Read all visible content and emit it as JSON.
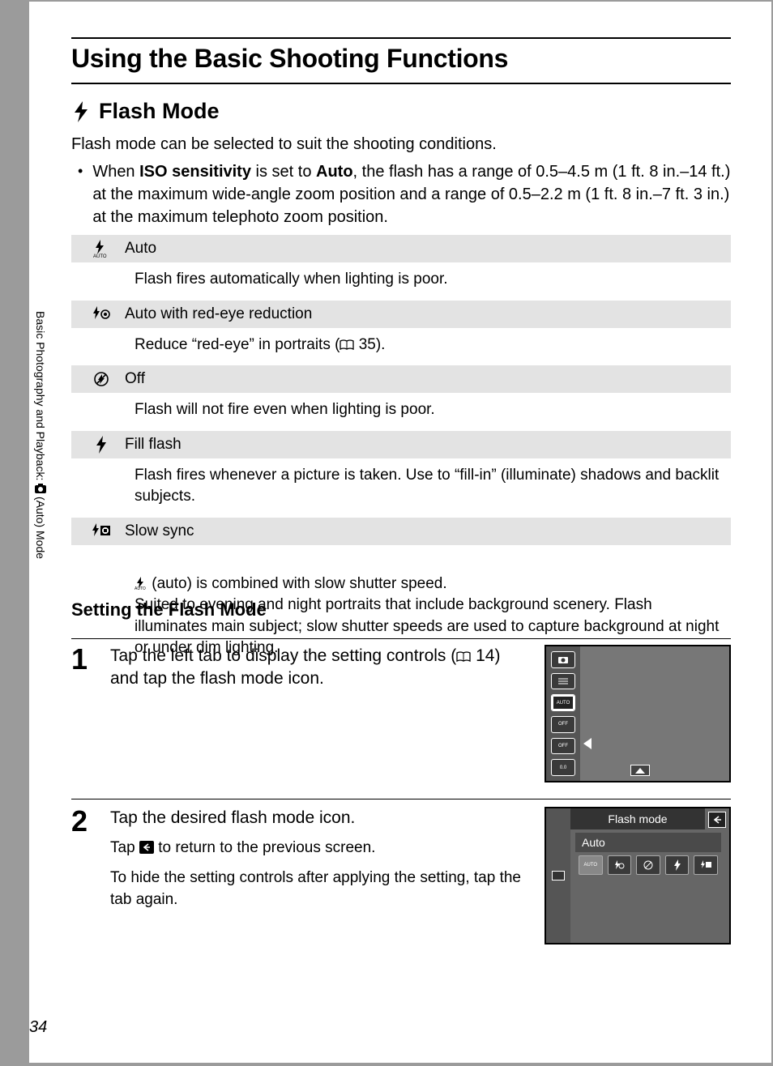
{
  "page_number": "34",
  "side_tab": {
    "prefix": "Basic Photography and Playback: ",
    "suffix": " (Auto) Mode"
  },
  "chapter_title": "Using the Basic Shooting Functions",
  "section": {
    "icon": "flash-bolt-icon",
    "title": "Flash Mode"
  },
  "intro": "Flash mode can be selected to suit the shooting conditions.",
  "bullet": {
    "pre": "When ",
    "b1": "ISO sensitivity",
    "mid": " is set to ",
    "b2": "Auto",
    "post": ", the flash has a range of 0.5–4.5 m (1 ft. 8 in.–14 ft.) at the maximum wide-angle zoom position and a range of 0.5–2.2 m (1 ft. 8 in.–7 ft. 3 in.) at the maximum telephoto zoom position."
  },
  "modes": [
    {
      "icon": "flash-auto-icon",
      "name": "Auto",
      "desc": "Flash fires automatically when lighting is poor."
    },
    {
      "icon": "flash-redeye-icon",
      "name": "Auto with red-eye reduction",
      "desc_pre": "Reduce “red-eye” in portraits (",
      "ref": "35",
      "desc_post": ")."
    },
    {
      "icon": "flash-off-icon",
      "name": "Off",
      "desc": "Flash will not fire even when lighting is poor."
    },
    {
      "icon": "flash-fill-icon",
      "name": "Fill flash",
      "desc": "Flash fires whenever a picture is taken. Use to “fill-in” (illuminate) shadows and backlit subjects."
    },
    {
      "icon": "flash-slowsync-icon",
      "name": "Slow sync",
      "desc_pre": "",
      "desc_post": " (auto) is combined with slow shutter speed.\nSuited to evening and night portraits that include background scenery. Flash illuminates main subject; slow shutter speeds are used to capture background at night or under dim lighting."
    }
  ],
  "subheading": "Setting the Flash Mode",
  "steps": {
    "s1": {
      "num": "1",
      "main_pre": "Tap the left tab to display the setting controls (",
      "ref": "14",
      "main_post": ") and tap the flash mode icon."
    },
    "s2": {
      "num": "2",
      "main": "Tap the desired flash mode icon.",
      "p1_pre": "Tap ",
      "p1_post": " to return to the previous screen.",
      "p2": "To hide the setting controls after applying the setting, tap the tab again."
    }
  },
  "screens": {
    "s1": {
      "panel_items": [
        "cam",
        "menu",
        "AUTO",
        "OFF",
        "OFF",
        "0.0"
      ]
    },
    "s2": {
      "title": "Flash mode",
      "selected": "Auto",
      "icons": [
        "AUTO",
        "redeye",
        "off",
        "fill",
        "slow"
      ]
    }
  }
}
